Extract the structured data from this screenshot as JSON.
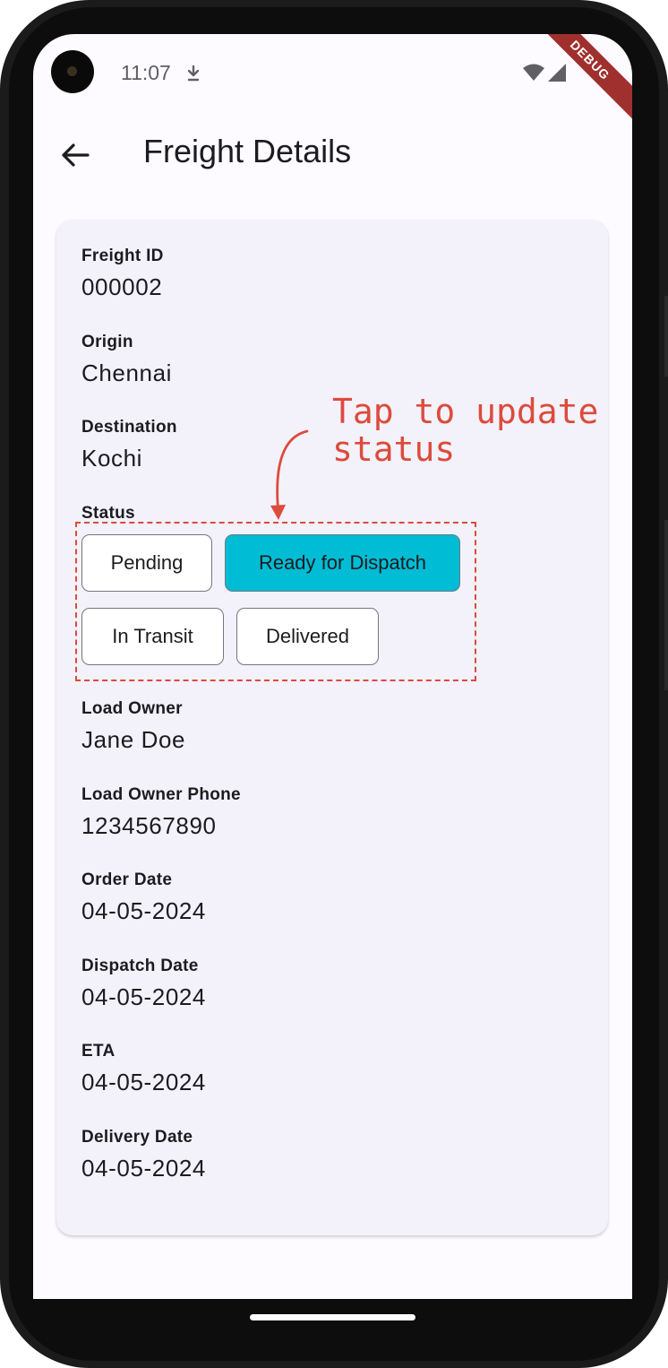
{
  "status_bar": {
    "time": "11:07",
    "icons": [
      "camera-hole",
      "download-indicator-icon",
      "wifi-icon",
      "cell-signal-icon"
    ]
  },
  "debug_banner": "DEBUG",
  "app_bar": {
    "back_icon": "arrow-back-icon",
    "title": "Freight Details"
  },
  "details": {
    "freight_id": {
      "label": "Freight ID",
      "value": "000002"
    },
    "origin": {
      "label": "Origin",
      "value": "Chennai"
    },
    "destination": {
      "label": "Destination",
      "value": "Kochi"
    },
    "status": {
      "label": "Status",
      "options": [
        "Pending",
        "Ready for Dispatch",
        "In Transit",
        "Delivered"
      ],
      "selected": "Ready for Dispatch"
    },
    "load_owner": {
      "label": "Load Owner",
      "value": "Jane Doe"
    },
    "load_owner_phone": {
      "label": "Load Owner Phone",
      "value": "1234567890"
    },
    "order_date": {
      "label": "Order Date",
      "value": "04-05-2024"
    },
    "dispatch_date": {
      "label": "Dispatch Date",
      "value": "04-05-2024"
    },
    "eta": {
      "label": "ETA",
      "value": "04-05-2024"
    },
    "delivery_date": {
      "label": "Delivery Date",
      "value": "04-05-2024"
    }
  },
  "annotation": {
    "text": "Tap to update\nstatus",
    "color": "#dc4b3c"
  },
  "colors": {
    "selected_chip": "#00bcd4",
    "card_background": "#f3f1fa",
    "screen_background": "#fdfbff"
  }
}
